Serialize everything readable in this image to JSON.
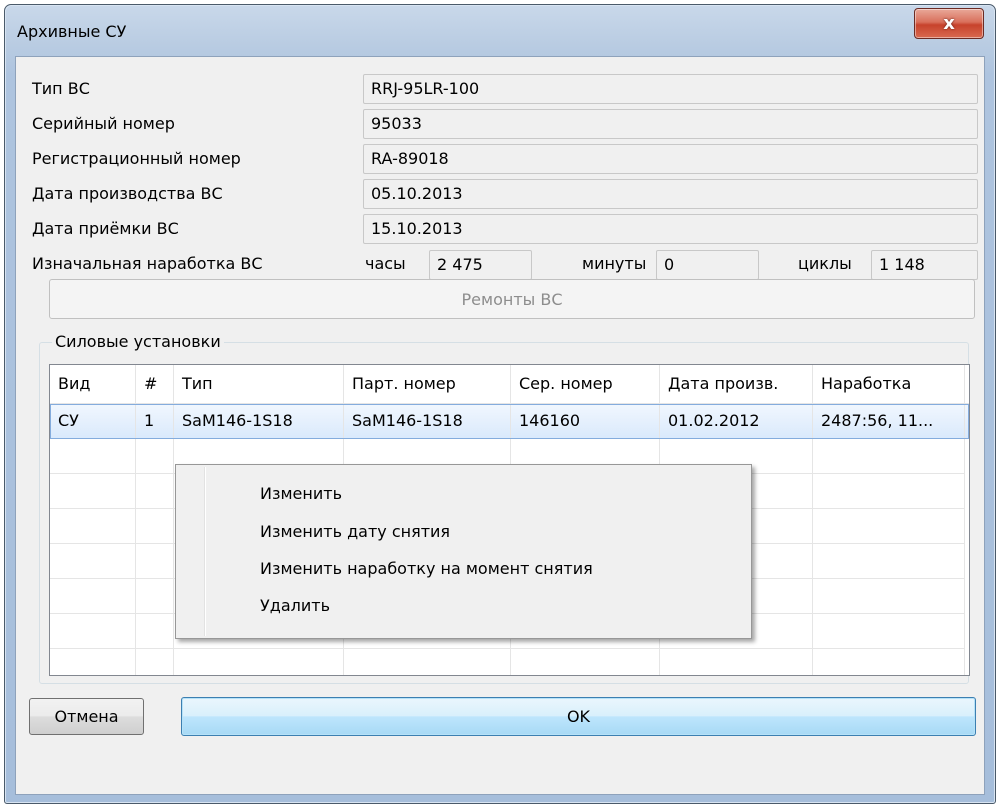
{
  "window": {
    "title": "Архивные СУ",
    "close_label": "x"
  },
  "aircraft": {
    "type_label": "Тип ВС",
    "type_value": "RRJ-95LR-100",
    "serial_label": "Серийный номер",
    "serial_value": "95033",
    "reg_label": "Регистрационный номер",
    "reg_value": "RA-89018",
    "prod_date_label": "Дата производства ВС",
    "prod_date_value": "05.10.2013",
    "accept_date_label": "Дата приёмки ВС",
    "accept_date_value": "15.10.2013",
    "initial_label": "Изначальная наработка ВС",
    "hours_label": "часы",
    "hours_value": "2 475",
    "minutes_label": "минуты",
    "minutes_value": "0",
    "cycles_label": "циклы",
    "cycles_value": "1 148"
  },
  "repairs_button": "Ремонты ВС",
  "group": {
    "title": "Силовые установки",
    "columns": [
      "Вид",
      "#",
      "Тип",
      "Парт. номер",
      "Сер. номер",
      "Дата произв.",
      "Наработка"
    ],
    "rows": [
      [
        "СУ",
        "1",
        "SaM146-1S18",
        "SaM146-1S18",
        "146160",
        "01.02.2012",
        "2487:56, 11..."
      ]
    ]
  },
  "context_menu": {
    "items": [
      "Изменить",
      "Изменить дату снятия",
      "Изменить наработку на момент снятия",
      "Удалить"
    ]
  },
  "buttons": {
    "cancel": "Отмена",
    "ok": "OK"
  }
}
